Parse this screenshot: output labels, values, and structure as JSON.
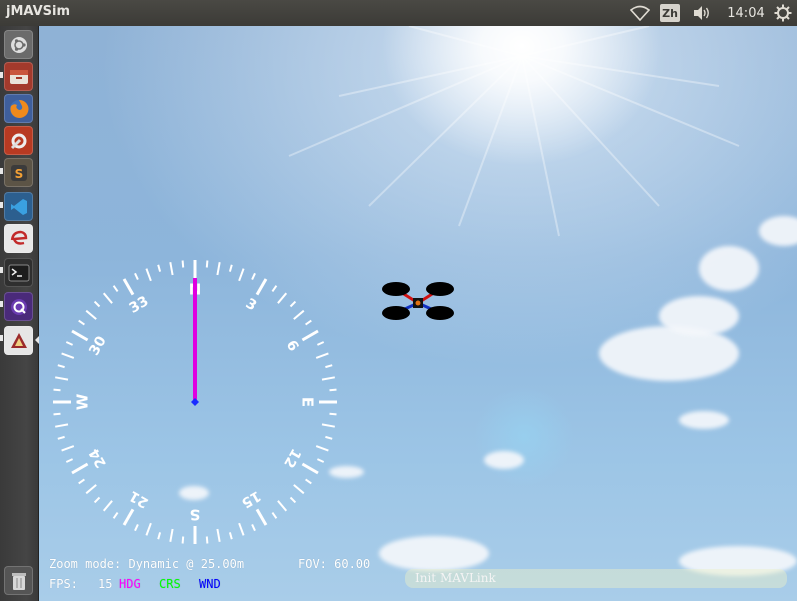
{
  "window": {
    "title": "jMAVSim"
  },
  "panel": {
    "language": "Zh",
    "clock": "14:04",
    "icons": [
      "wifi-icon",
      "volume-icon",
      "power-gear-icon"
    ]
  },
  "launcher": {
    "items": [
      {
        "name": "ubuntu-dash-icon"
      },
      {
        "name": "files-icon"
      },
      {
        "name": "firefox-icon"
      },
      {
        "name": "system-settings-icon"
      },
      {
        "name": "sublime-text-icon"
      },
      {
        "name": "code-editor-icon"
      },
      {
        "name": "eclipse-icon"
      },
      {
        "name": "terminal-icon"
      },
      {
        "name": "qgroundcontrol-icon"
      },
      {
        "name": "jmavsim-java-icon"
      },
      {
        "name": "trash-icon"
      }
    ]
  },
  "compass": {
    "labels": {
      "n": "N",
      "e": "E",
      "s": "S",
      "w": "W",
      "3": "3",
      "6": "6",
      "12": "12",
      "15": "15",
      "21": "21",
      "24": "24",
      "30": "30",
      "33": "33"
    },
    "heading_deg": 0,
    "colors": {
      "heading": "#ff00ff",
      "course": "#00ff00",
      "wind": "#0000ff",
      "dial": "#ffffff"
    }
  },
  "hud": {
    "zoom_line": "Zoom mode: Dynamic @ 25.00m",
    "fov_line": "FOV: 60.00",
    "fps_label": "FPS:",
    "fps_value": "15",
    "hdg": "HDG",
    "crs": "CRS",
    "wnd": "WND"
  },
  "status": {
    "message": "Init MAVLink"
  }
}
